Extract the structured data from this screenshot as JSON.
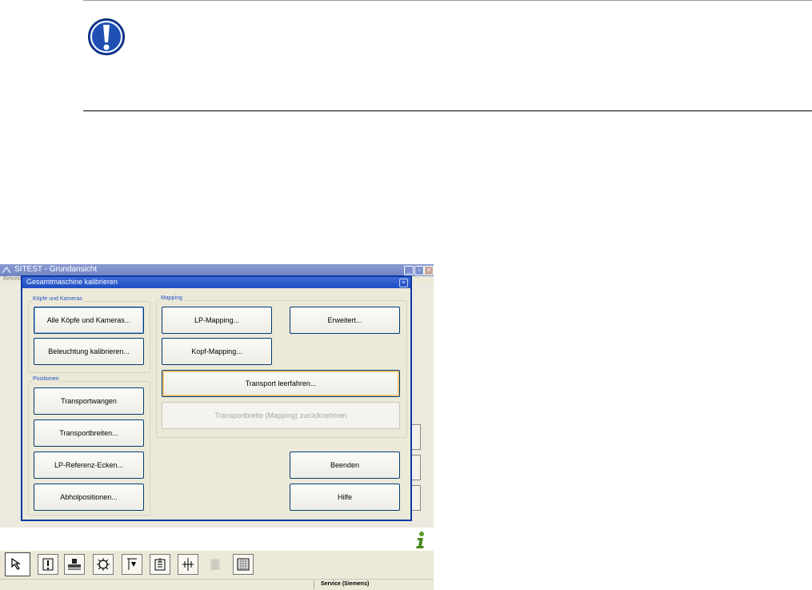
{
  "app": {
    "title": "SITEST - Grundansicht",
    "menu_label": "Betrieb",
    "status_user": "Service (Siemens)"
  },
  "dialog": {
    "title": "Gesamtmaschine kalibrieren",
    "groups": {
      "heads": "Köpfe und Kameras",
      "positions": "Positionen",
      "mapping": "Mapping"
    },
    "buttons": {
      "all_heads": "Alle Köpfe und Kameras...",
      "lighting": "Beleuchtung kalibrieren...",
      "transport_jaws": "Transportwangen",
      "transport_widths": "Transportbreiten...",
      "lp_ref_corners": "LP-Referenz-Ecken...",
      "pickup_positions": "Abholpositionen...",
      "lp_mapping": "LP-Mapping...",
      "advanced": "Erweitert...",
      "head_mapping": "Kopf-Mapping...",
      "transport_clear": "Transport leerfahren...",
      "transport_width_undo": "Transportbreite (Mapping) zurücknehmen",
      "close": "Beenden",
      "help": "Hilfe"
    }
  },
  "icons": {
    "notice": "exclamation-icon",
    "info": "info-icon",
    "toolbar": [
      "pointer-icon",
      "alert-icon",
      "machine-icon",
      "gear-icon",
      "download-icon",
      "feeder-icon",
      "calibrate-icon",
      "list-icon",
      "grid-icon"
    ]
  },
  "colors": {
    "dialog_border": "#0839a5",
    "group_label": "#2554c7",
    "notice_blue": "#1f4fb3"
  }
}
